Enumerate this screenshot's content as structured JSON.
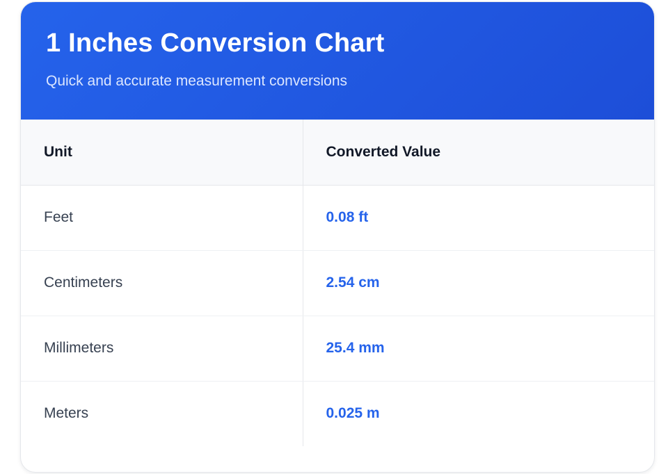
{
  "header": {
    "title": "1 Inches Conversion Chart",
    "subtitle": "Quick and accurate measurement conversions"
  },
  "table": {
    "columns": [
      "Unit",
      "Converted Value"
    ],
    "rows": [
      {
        "unit": "Feet",
        "value": "0.08 ft"
      },
      {
        "unit": "Centimeters",
        "value": "2.54 cm"
      },
      {
        "unit": "Millimeters",
        "value": "25.4 mm"
      },
      {
        "unit": "Meters",
        "value": "0.025 m"
      }
    ]
  },
  "colors": {
    "header_gradient_start": "#2563eb",
    "header_gradient_end": "#1d4ed8",
    "value_text": "#2563eb",
    "table_header_bg": "#f8f9fb"
  }
}
